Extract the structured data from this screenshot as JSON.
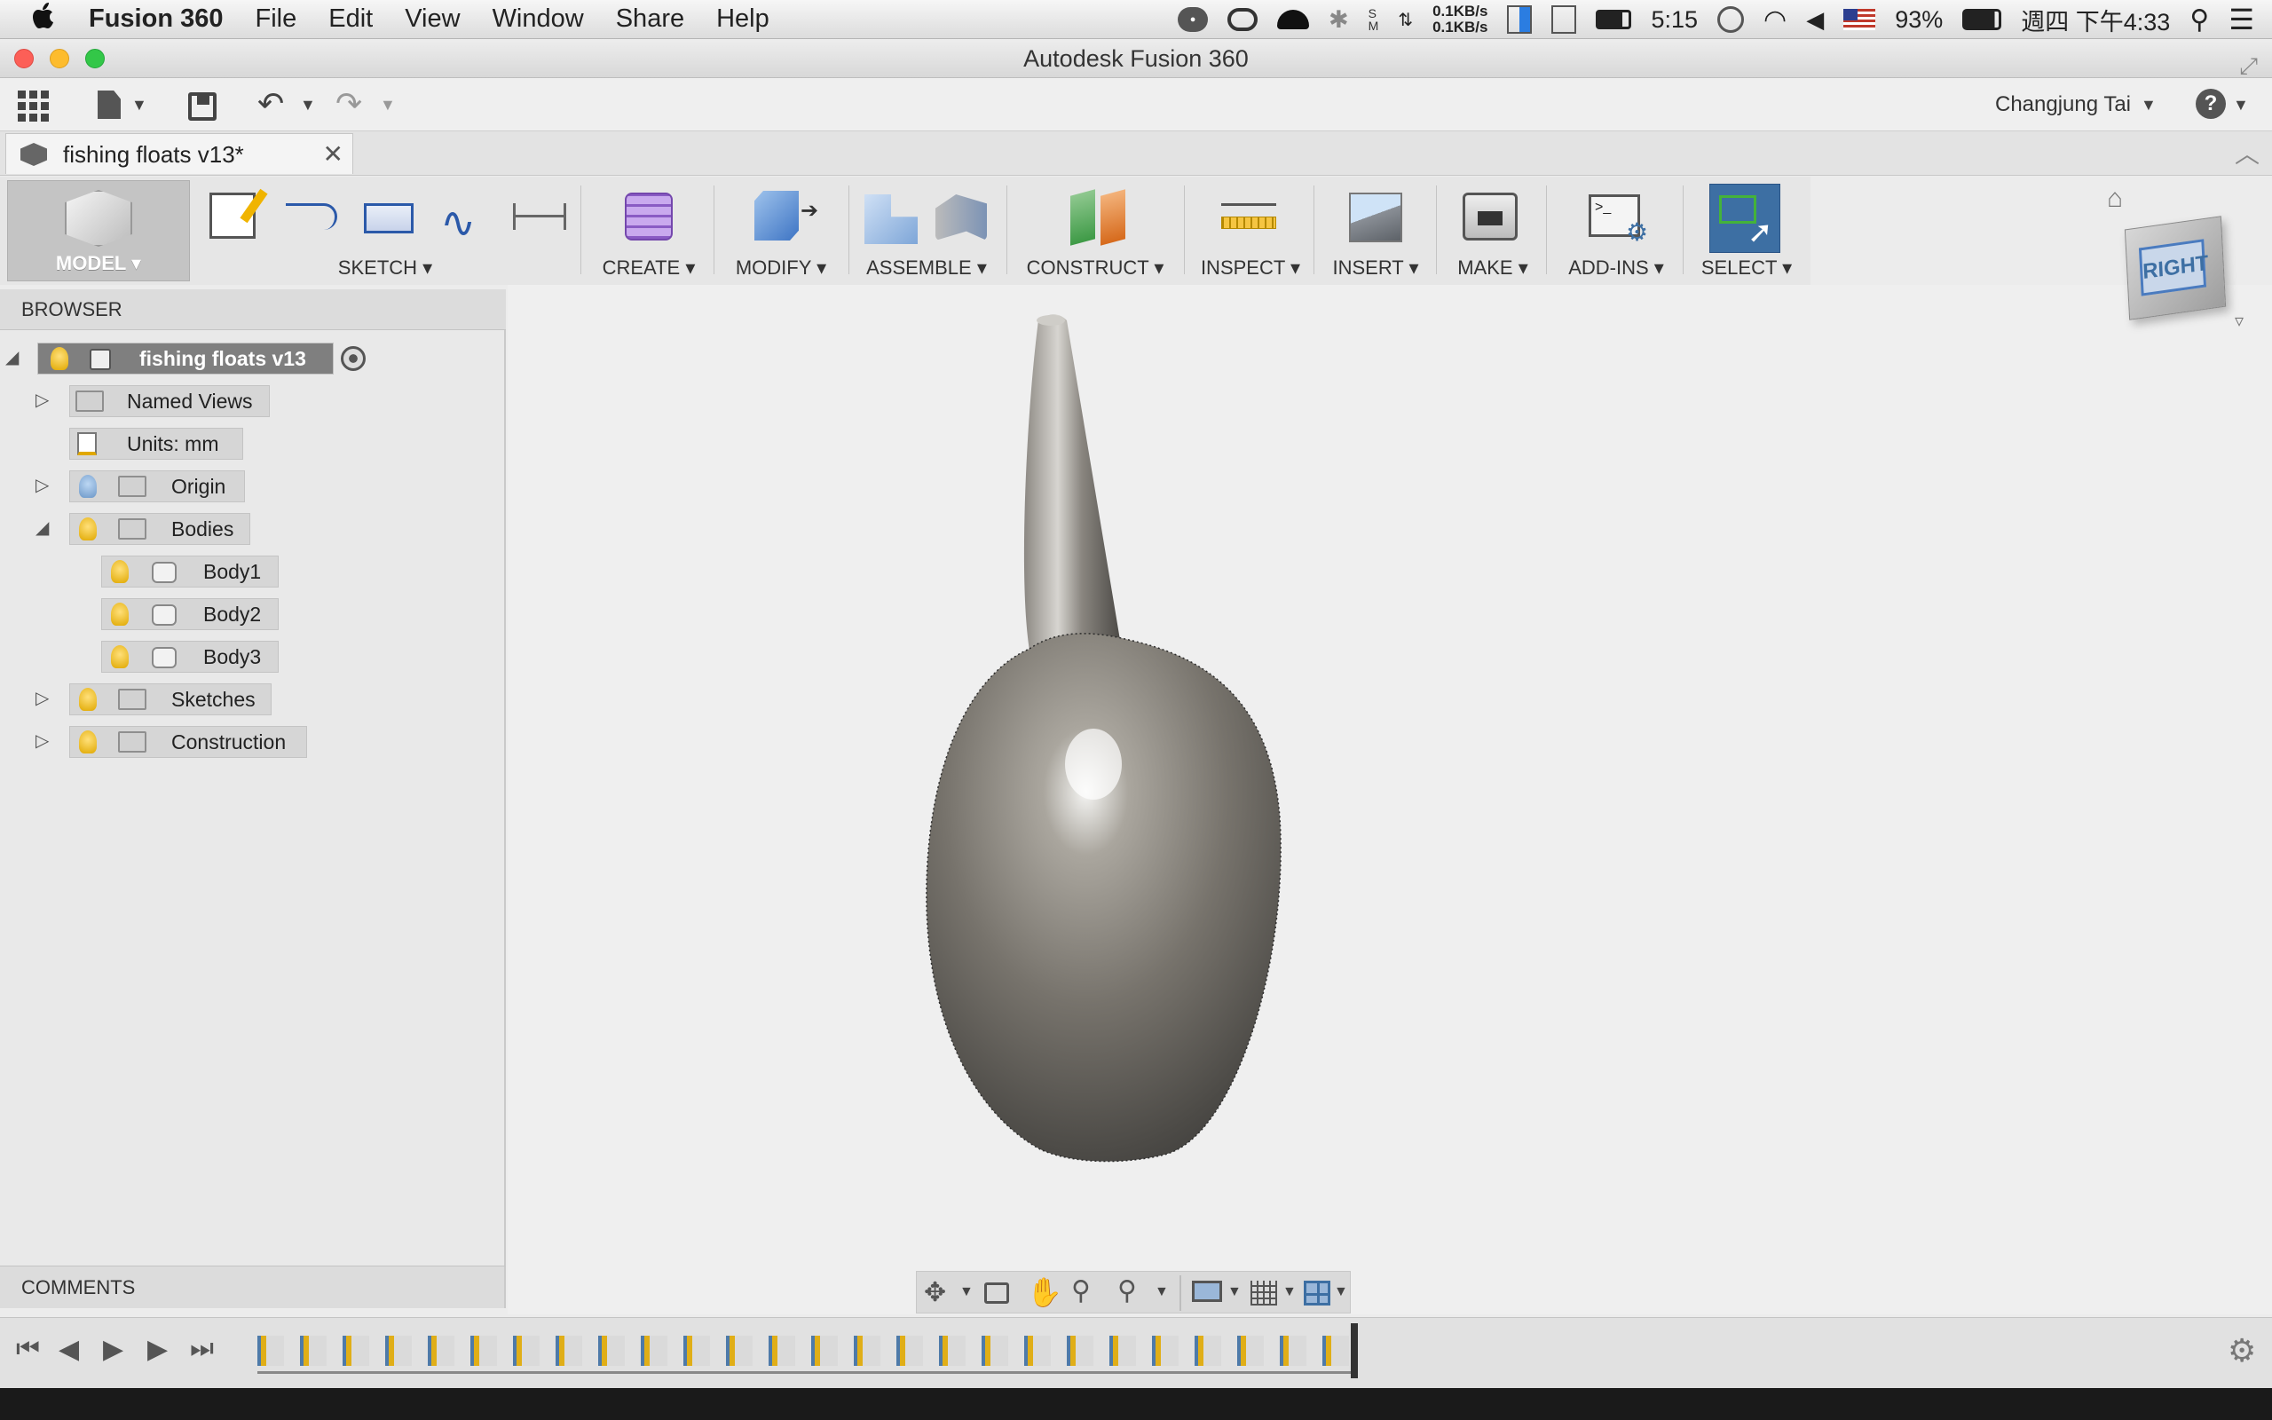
{
  "menubar": {
    "app_name": "Fusion 360",
    "items": [
      "File",
      "Edit",
      "View",
      "Window",
      "Share",
      "Help"
    ],
    "net_up": "0.1KB/s",
    "net_down": "0.1KB/s",
    "volume_time": "5:15",
    "battery": "93%",
    "clock": "週四 下午4:33"
  },
  "window": {
    "title": "Autodesk Fusion 360"
  },
  "qat": {
    "user": "Changjung Tai"
  },
  "document_tab": {
    "label": "fishing floats v13*"
  },
  "ribbon": {
    "workspace": "MODEL",
    "groups": [
      "SKETCH",
      "CREATE",
      "MODIFY",
      "ASSEMBLE",
      "CONSTRUCT",
      "INSPECT",
      "INSERT",
      "MAKE",
      "ADD-INS",
      "SELECT"
    ]
  },
  "viewcube": {
    "face": "RIGHT"
  },
  "browser": {
    "header": "BROWSER",
    "root": "fishing floats v13",
    "nodes": {
      "named_views": "Named Views",
      "units": "Units: mm",
      "origin": "Origin",
      "bodies": "Bodies",
      "body1": "Body1",
      "body2": "Body2",
      "body3": "Body3",
      "sketches": "Sketches",
      "construction": "Construction"
    }
  },
  "comments": {
    "header": "COMMENTS"
  },
  "colors": {
    "accent_select": "#3d6fa3",
    "root_node": "#7f7f7f",
    "mac_red": "#fc5f57",
    "mac_yellow": "#fdbc2e",
    "mac_green": "#33c748"
  }
}
